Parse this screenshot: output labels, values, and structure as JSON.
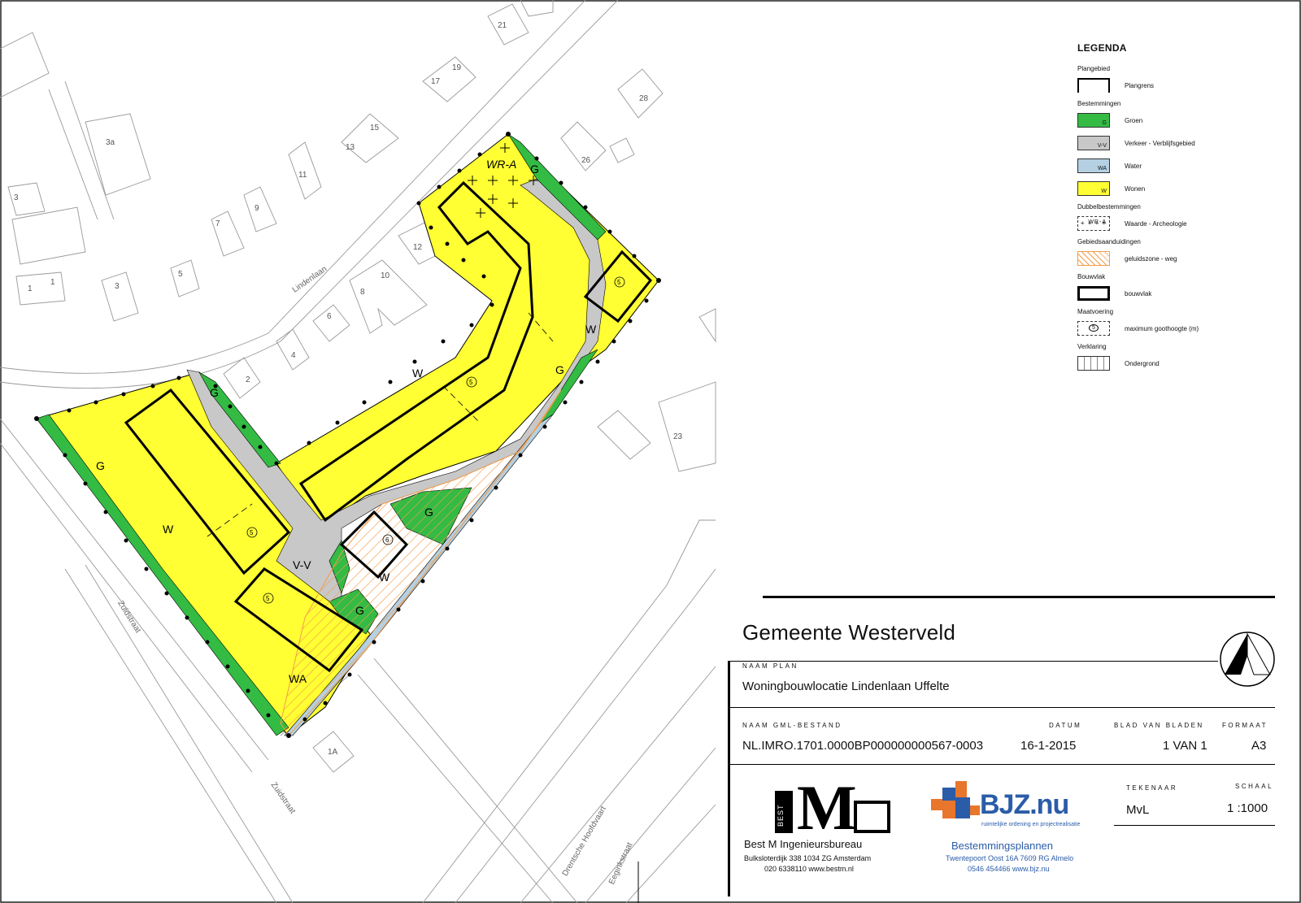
{
  "map": {
    "street_labels": [
      "Lindenlaan",
      "Zuidstraat",
      "Zuidstraat",
      "Drentsche Hoofdvaart",
      "Eeginkstraat"
    ],
    "house_numbers": [
      "21",
      "19",
      "17",
      "28",
      "15",
      "13",
      "26",
      "11",
      "3a",
      "9",
      "7",
      "3",
      "5",
      "12",
      "10",
      "1",
      "1",
      "3",
      "8",
      "6",
      "4",
      "2",
      "23",
      "1A"
    ],
    "zone_labels": {
      "wr_a": "WR-A",
      "g1": "G",
      "g2": "G",
      "g3": "G",
      "g4": "G",
      "g5": "G",
      "g6": "G",
      "w1": "W",
      "w2": "W",
      "w3": "W",
      "w4": "W",
      "vv": "V-V",
      "wa": "WA"
    },
    "height_markers": [
      "5",
      "5",
      "5",
      "5",
      "6"
    ],
    "colors": {
      "groen": "#33bb44",
      "verkeer": "#c8c8c8",
      "water": "#b5d0e2",
      "wonen": "#ffff33",
      "geluid": "#f39c4a"
    }
  },
  "legend": {
    "title": "LEGENDA",
    "sections": {
      "plangebied": "Plangebied",
      "plangrens": "Plangrens",
      "bestemmingen": "Bestemmingen",
      "groen": "Groen",
      "groen_code": "G",
      "verkeer": "Verkeer - Verblijfsgebied",
      "verkeer_code": "V-V",
      "water": "Water",
      "water_code": "WA",
      "wonen": "Wonen",
      "wonen_code": "W",
      "dubbel": "Dubbelbestemmingen",
      "archeologie": "Waarde - Archeologie",
      "archeologie_code": "WR-A",
      "gebied": "Gebiedsaanduidingen",
      "geluid": "geluidszone - weg",
      "bouwvlak_head": "Bouwvlak",
      "bouwvlak": "bouwvlak",
      "maatvoering": "Maatvoering",
      "goothoogte": "maximum goothoogte (m)",
      "goothoogte_code": "5",
      "verklaring": "Verklaring",
      "ondergrond": "Ondergrond"
    }
  },
  "title_block": {
    "gemeente": "Gemeente Westerveld",
    "naam_plan_caption": "NAAM PLAN",
    "naam_plan": "Woningbouwlocatie Lindenlaan Uffelte",
    "gml_caption": "NAAM GML-BESTAND",
    "gml": "NL.IMRO.1701.0000BP000000000567-0003",
    "datum_caption": "DATUM",
    "datum": "16-1-2015",
    "blad_caption": "BLAD VAN BLADEN",
    "blad": "1 VAN 1",
    "formaat_caption": "FORMAAT",
    "formaat": "A3",
    "tekenaar_caption": "TEKENAAR",
    "tekenaar": "MvL",
    "schaal_caption": "SCHAAL",
    "schaal": "1 :1000",
    "bestm": {
      "mark": "BEST",
      "name": "Best M Ingenieursbureau",
      "address": "Bulksloterdijk 338  1034 ZG   Amsterdam",
      "contact": "020  6338110   www.bestm.nl"
    },
    "bjz": {
      "mark": "BJZ.nu",
      "tagline": "ruimtelijke ordening en projectrealisatie",
      "name": "Bestemmingsplannen",
      "address": "Twentepoort Oost 16A 7609 RG Almelo",
      "contact": "0546 454466   www.bjz.nu"
    }
  }
}
